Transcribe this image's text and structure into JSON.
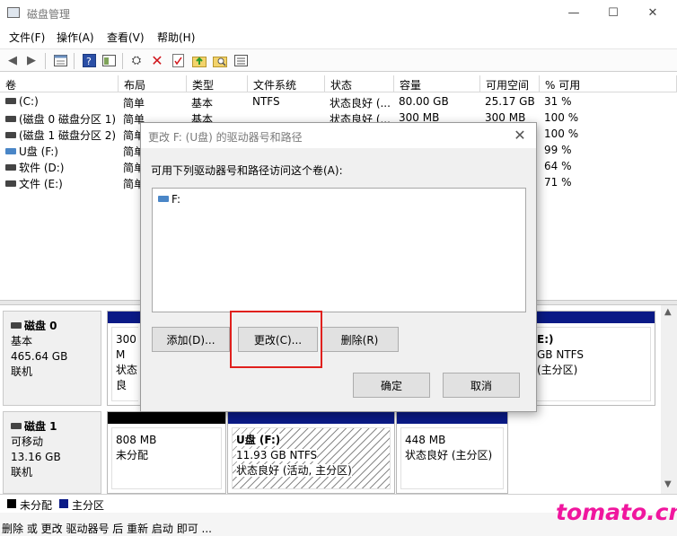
{
  "window": {
    "title": "磁盘管理",
    "controls": {
      "minimize": "—",
      "maximize": "☐",
      "close": "✕"
    }
  },
  "menu": [
    "文件(F)",
    "操作(A)",
    "查看(V)",
    "帮助(H)"
  ],
  "table": {
    "headers": [
      "卷",
      "布局",
      "类型",
      "文件系统",
      "状态",
      "容量",
      "可用空间",
      "% 可用"
    ],
    "rows": [
      {
        "volume": "(C:)",
        "layout": "简单",
        "type": "基本",
        "fs": "NTFS",
        "status": "状态良好 (...",
        "capacity": "80.00 GB",
        "free": "25.17 GB",
        "pct": "31 %",
        "icon": "disk-icon"
      },
      {
        "volume": "(磁盘 0 磁盘分区 1)",
        "layout": "简单",
        "type": "基本",
        "fs": "",
        "status": "状态良好 (...",
        "capacity": "300 MB",
        "free": "300 MB",
        "pct": "100 %",
        "icon": "disk-icon"
      },
      {
        "volume": "(磁盘 1 磁盘分区 2)",
        "layout": "简单",
        "type": "",
        "fs": "",
        "status": "",
        "capacity": "",
        "free": "",
        "pct": "100 %",
        "icon": "disk-icon"
      },
      {
        "volume": "U盘 (F:)",
        "layout": "简单",
        "type": "",
        "fs": "",
        "status": "",
        "capacity": "",
        "free": "",
        "pct": "99 %",
        "icon": "usb-drive-icon"
      },
      {
        "volume": "软件 (D:)",
        "layout": "简单",
        "type": "",
        "fs": "",
        "status": "",
        "capacity": "",
        "free": "",
        "pct": "64 %",
        "icon": "disk-icon"
      },
      {
        "volume": "文件 (E:)",
        "layout": "简单",
        "type": "",
        "fs": "",
        "status": "",
        "capacity": "",
        "free": "",
        "pct": "71 %",
        "icon": "disk-icon"
      }
    ]
  },
  "disks": [
    {
      "name": "磁盘 0",
      "kind": "基本",
      "size": "465.64 GB",
      "state": "联机",
      "partitions": [
        {
          "line1": "300 M",
          "line2": "状态良"
        },
        {
          "line1": "E:)",
          "line2": "GB NTFS",
          "line3": "(主分区)"
        }
      ]
    },
    {
      "name": "磁盘 1",
      "kind": "可移动",
      "size": "13.16 GB",
      "state": "联机",
      "partitions": [
        {
          "line1": "808 MB",
          "line2": "未分配"
        },
        {
          "line1": "U盘  (F:)",
          "line2": "11.93 GB NTFS",
          "line3": "状态良好 (活动, 主分区)"
        },
        {
          "line1": "448 MB",
          "line2": "状态良好 (主分区)"
        }
      ]
    }
  ],
  "legend": {
    "unallocated": "未分配",
    "primary": "主分区"
  },
  "colors": {
    "unallocated": "#000000",
    "primary": "#0a1a86",
    "highlight": "#e0201d",
    "watermark": "#f0169e"
  },
  "status_text": "删除 或 更改 驱动器号 后 重新 启动 即可 ...",
  "watermark": "tomato.cm",
  "dialog": {
    "title": "更改 F: (U盘) 的驱动器号和路径",
    "prompt": "可用下列驱动器号和路径访问这个卷(A):",
    "list_items": [
      "F:"
    ],
    "buttons": {
      "add": "添加(D)...",
      "change": "更改(C)...",
      "remove": "删除(R)",
      "ok": "确定",
      "cancel": "取消"
    }
  }
}
